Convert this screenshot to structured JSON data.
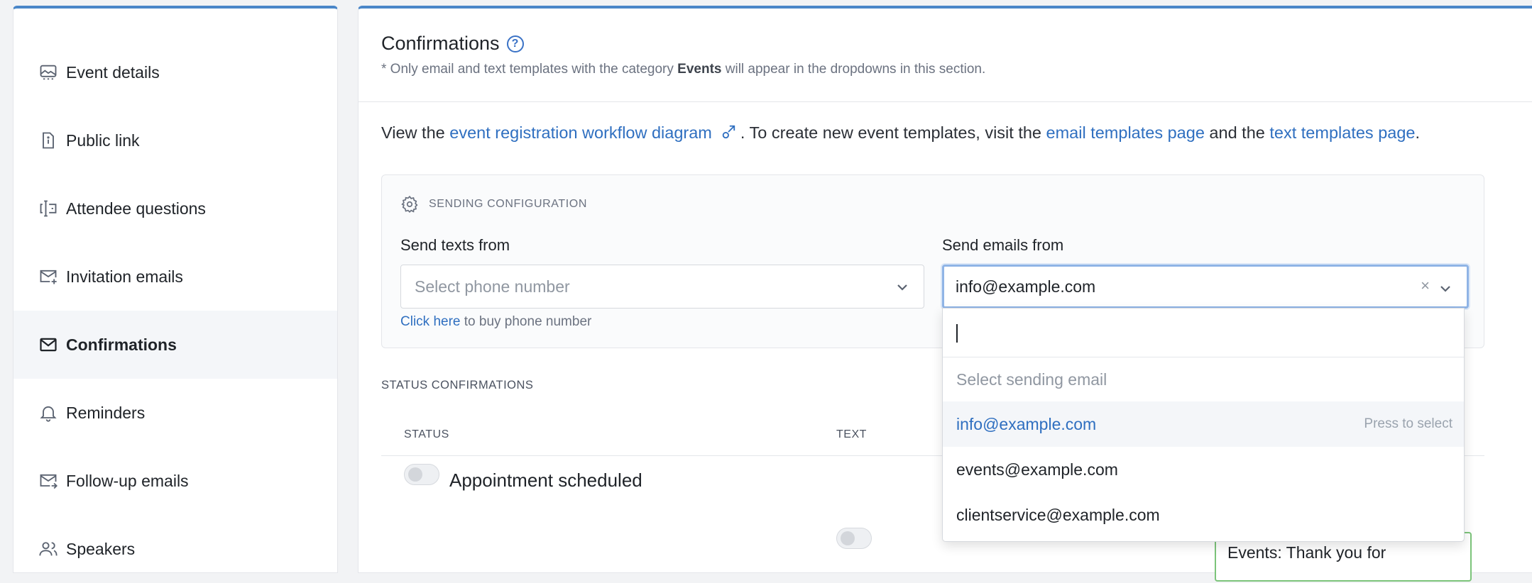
{
  "sidebar": {
    "items": [
      {
        "label": "Event details",
        "icon": "image-icon"
      },
      {
        "label": "Public link",
        "icon": "file-info-icon"
      },
      {
        "label": "Attendee questions",
        "icon": "text-input-icon"
      },
      {
        "label": "Invitation emails",
        "icon": "mail-sparkle-icon"
      },
      {
        "label": "Confirmations",
        "icon": "mail-icon",
        "active": true
      },
      {
        "label": "Reminders",
        "icon": "bell-icon"
      },
      {
        "label": "Follow-up emails",
        "icon": "mail-forward-icon"
      },
      {
        "label": "Speakers",
        "icon": "users-icon"
      }
    ]
  },
  "main": {
    "title": "Confirmations",
    "help_glyph": "?",
    "subtitle_pre": "* Only email and text templates with the category ",
    "subtitle_bold": "Events",
    "subtitle_post": " will appear in the dropdowns in this section.",
    "intro": {
      "pre": "View the ",
      "workflow_link": "event registration workflow diagram",
      "mid": ". To create new event templates, visit the ",
      "email_link": "email templates page",
      "and": " and the ",
      "text_link": "text templates page",
      "end": "."
    },
    "config": {
      "heading": "SENDING CONFIGURATION",
      "texts_label": "Send texts from",
      "texts_placeholder": "Select phone number",
      "buy_link": "Click here",
      "buy_text": " to buy phone number",
      "emails_label": "Send emails from",
      "emails_value": "info@example.com",
      "clear_glyph": "×"
    },
    "status": {
      "heading": "STATUS CONFIRMATIONS",
      "col_status": "STATUS",
      "col_text": "TEXT",
      "row_label": "Appointment scheduled",
      "text_preview": "Events: Thank you for"
    }
  },
  "dropdown": {
    "search_value": "",
    "placeholder": "Select sending email",
    "options": [
      "info@example.com",
      "events@example.com",
      "clientservice@example.com"
    ],
    "highlighted_hint": "Press to select"
  },
  "colors": {
    "accent": "#4a86c8",
    "link": "#2f6fc0",
    "success_border": "#7cc47a"
  }
}
